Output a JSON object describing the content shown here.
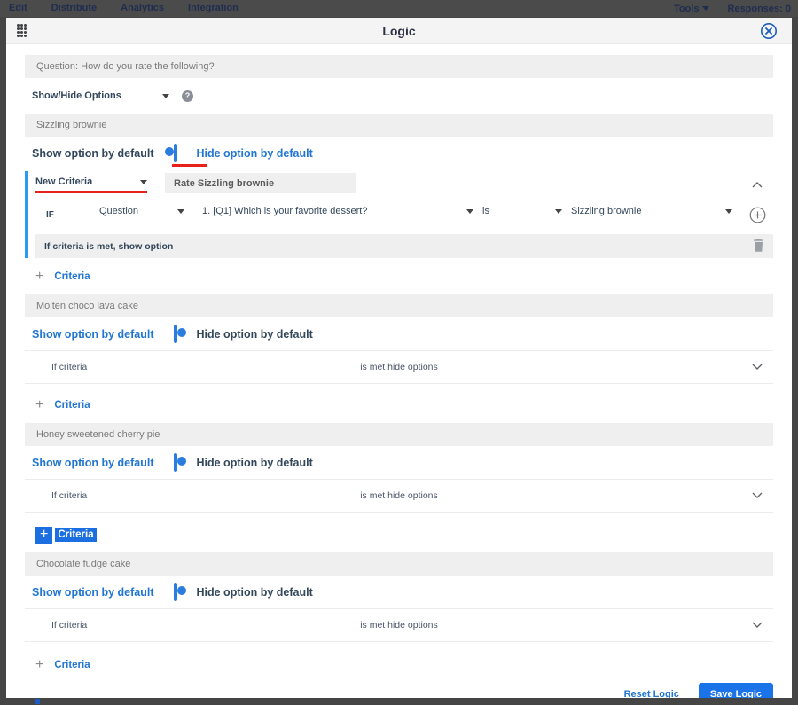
{
  "topbar": {
    "tabs": [
      {
        "label": "Edit",
        "active": true
      },
      {
        "label": "Distribute",
        "active": false
      },
      {
        "label": "Analytics",
        "active": false
      },
      {
        "label": "Integration",
        "active": false
      }
    ],
    "tools_label": "Tools",
    "responses_label": "Responses: 0"
  },
  "modal": {
    "title": "Logic",
    "question_bar": "Question: How do you rate the following?",
    "logic_type_dropdown": "Show/Hide Options",
    "footer": {
      "reset_label": "Reset Logic",
      "save_label": "Save Logic"
    }
  },
  "labels": {
    "show_default": "Show option by default",
    "hide_default": "Hide option by default",
    "add_criteria": "Criteria",
    "if": "IF",
    "collapsed_left": "If criteria",
    "collapsed_mid": "is met hide options"
  },
  "icons": {
    "help_glyph": "?",
    "plus_glyph": "+"
  },
  "sections": [
    {
      "title": "Sizzling brownie",
      "toggle_state": "hide-selected",
      "criteria": {
        "name_dropdown": "New Criteria",
        "rate_input": "Rate Sizzling brownie",
        "type_dropdown": "Question",
        "question_dropdown": "1. [Q1] Which is your favorite dessert?",
        "operator_dropdown": "is",
        "value_dropdown": "Sizzling brownie",
        "result_label": "If criteria is met, show option"
      }
    },
    {
      "title": "Molten choco lava cake",
      "toggle_state": "show-selected"
    },
    {
      "title": "Honey sweetened cherry pie",
      "toggle_state": "show-selected"
    },
    {
      "title": "Chocolate fudge cake",
      "toggle_state": "show-selected"
    }
  ],
  "colors": {
    "accent_blue": "#1a73e8",
    "link_blue": "#2176d2",
    "toggle_blue": "#2b7cdf",
    "annotation_red": "#e8211d",
    "panel_border_blue": "#2b9af3",
    "topbar_bg": "#4b4b4b"
  }
}
